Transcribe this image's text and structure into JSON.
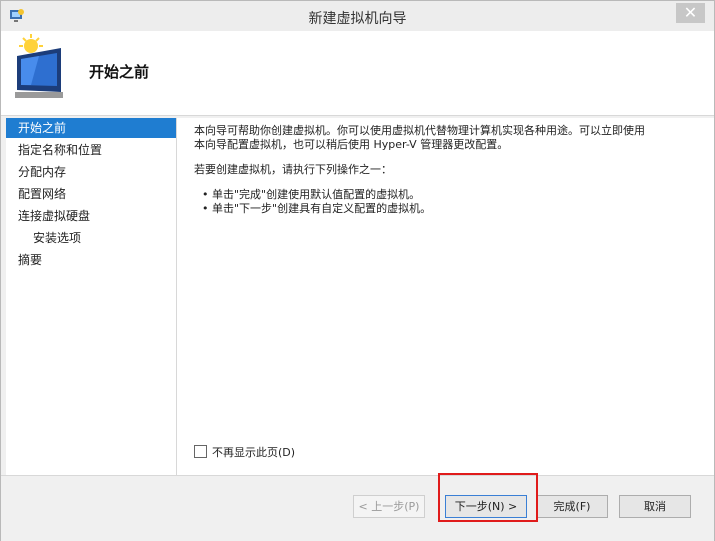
{
  "window": {
    "title": "新建虚拟机向导",
    "close_glyph": "✕"
  },
  "header": {
    "title": "开始之前"
  },
  "nav": {
    "items": [
      {
        "label": "开始之前",
        "selected": true
      },
      {
        "label": "指定名称和位置",
        "selected": false
      },
      {
        "label": "分配内存",
        "selected": false
      },
      {
        "label": "配置网络",
        "selected": false
      },
      {
        "label": "连接虚拟硬盘",
        "selected": false
      },
      {
        "label": "安装选项",
        "selected": false
      },
      {
        "label": "摘要",
        "selected": false
      }
    ]
  },
  "content": {
    "intro_line1": "本向导可帮助你创建虚拟机。你可以使用虚拟机代替物理计算机实现各种用途。可以立即使用",
    "intro_line2": "本向导配置虚拟机，也可以稍后使用 Hyper-V 管理器更改配置。",
    "instruction": "若要创建虚拟机，请执行下列操作之一：",
    "bullet1": "• 单击\"完成\"创建使用默认值配置的虚拟机。",
    "bullet2": "• 单击\"下一步\"创建具有自定义配置的虚拟机。",
    "checkbox_label": "不再显示此页(D)"
  },
  "footer": {
    "prev": "< 上一步(P)",
    "next": "下一步(N) >",
    "finish": "完成(F)",
    "cancel": "取消"
  },
  "colors": {
    "selection": "#1f7dd1",
    "highlight": "#e01b1b"
  }
}
